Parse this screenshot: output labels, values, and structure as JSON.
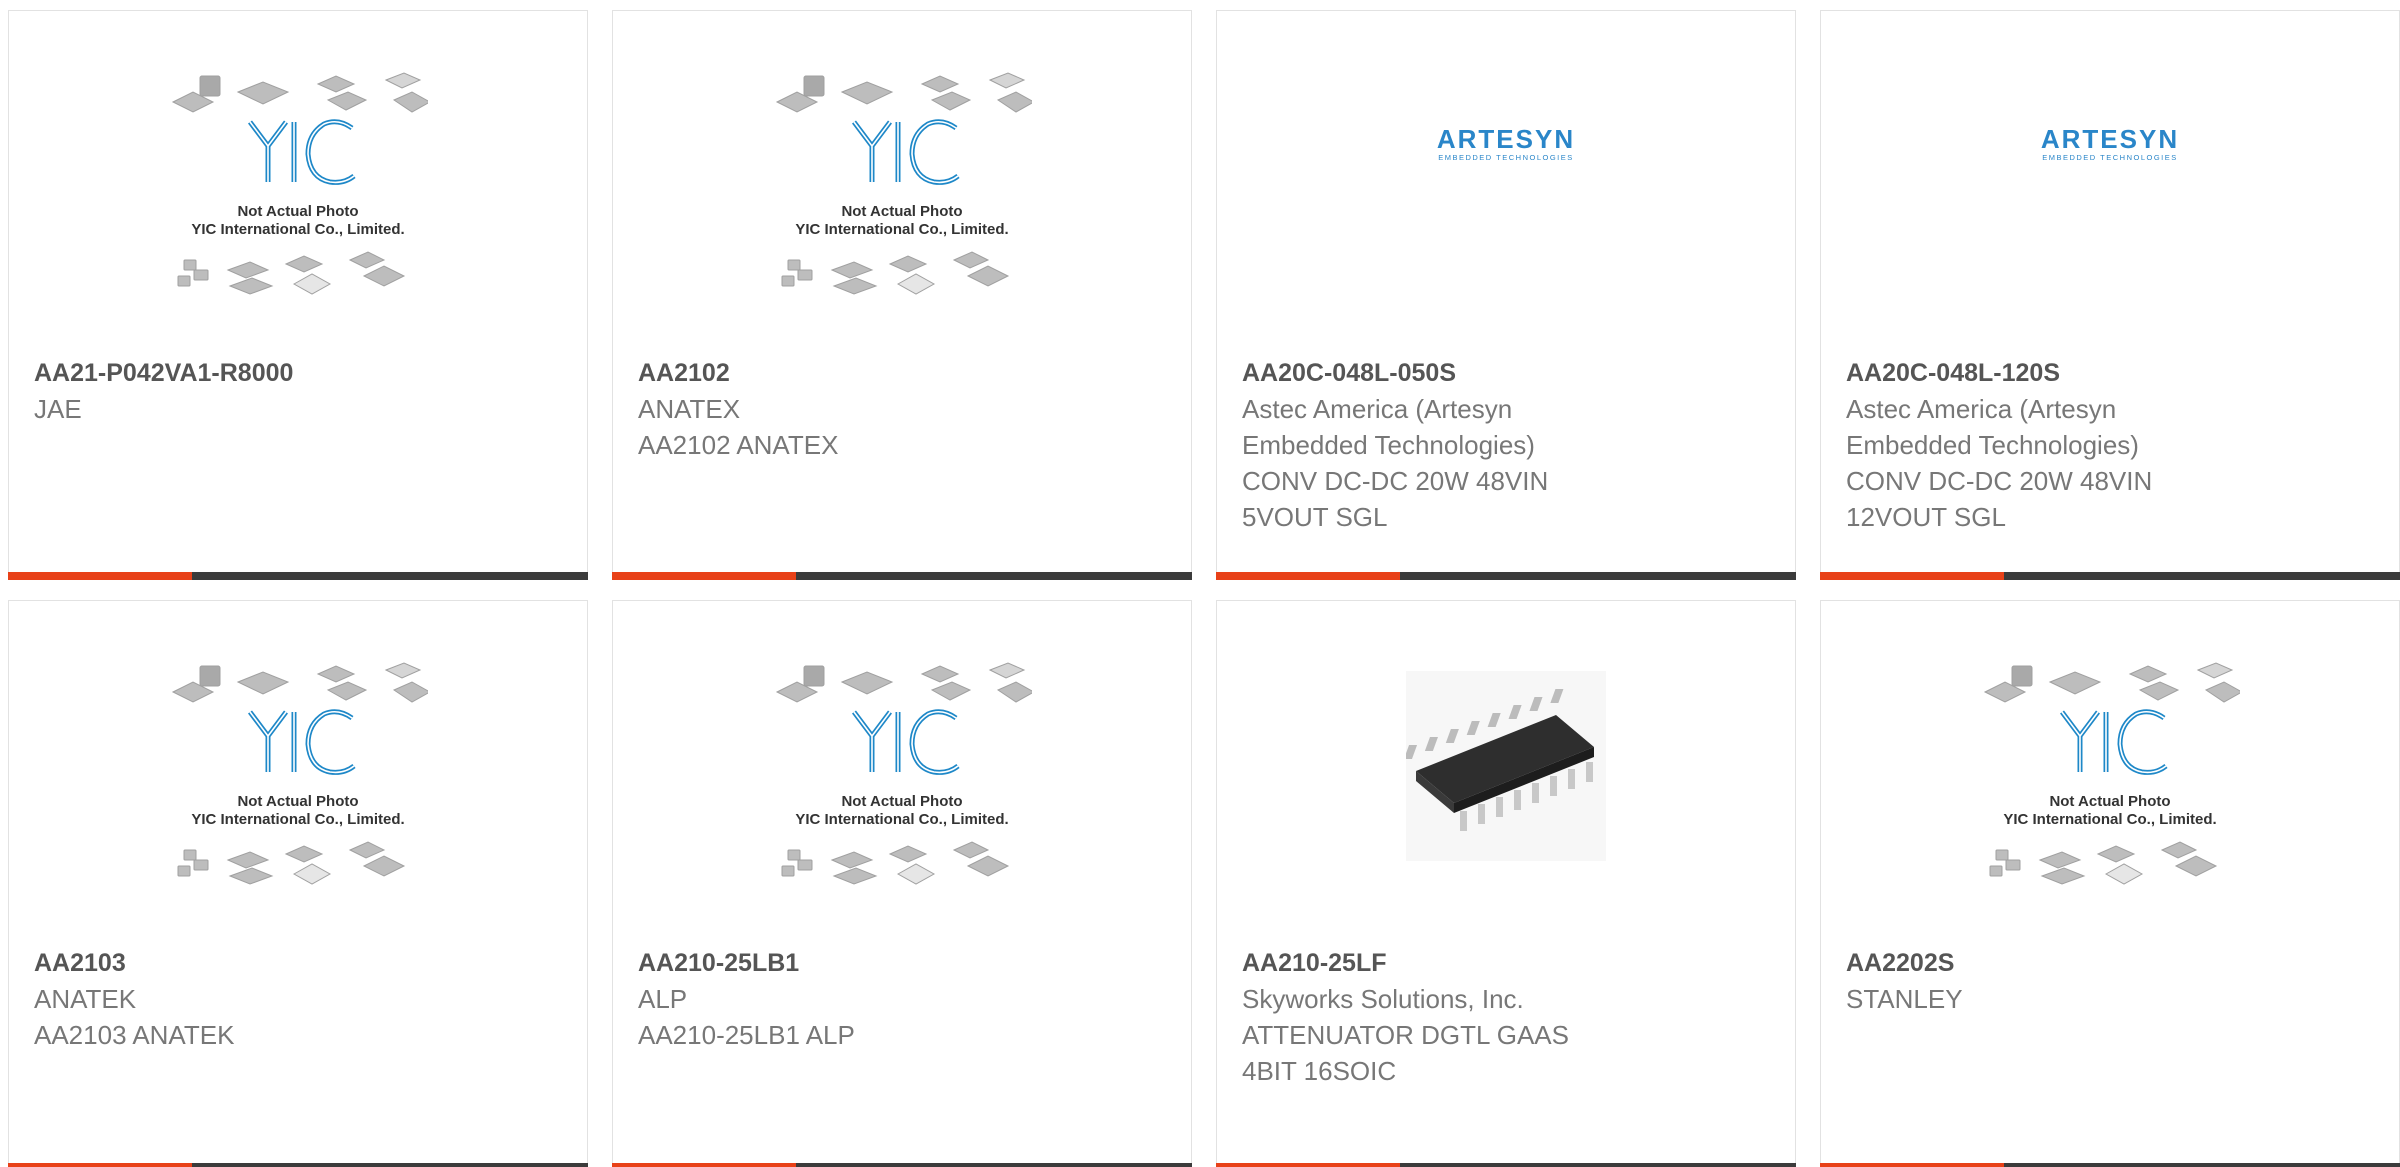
{
  "colors": {
    "accent": "#e84118",
    "bar": "#3b3b3b",
    "yic_blue": "#1e88c8",
    "artesyn_blue": "#2a86c9"
  },
  "placeholder": {
    "line1": "Not Actual Photo",
    "line2": "YIC International Co., Limited.",
    "logo": "YIC"
  },
  "artesyn": {
    "logo": "ARTESYN",
    "sub": "EMBEDDED TECHNOLOGIES"
  },
  "products": [
    {
      "part": "AA21-P042VA1-R8000",
      "manufacturer": "JAE",
      "description": "",
      "image": "yic-placeholder"
    },
    {
      "part": "AA2102",
      "manufacturer": "ANATEX",
      "description": "AA2102 ANATEX",
      "image": "yic-placeholder"
    },
    {
      "part": "AA20C-048L-050S",
      "manufacturer": "Astec America (Artesyn Embedded Technologies)",
      "description": "CONV DC-DC 20W 48VIN 5VOUT SGL",
      "image": "artesyn-logo"
    },
    {
      "part": "AA20C-048L-120S",
      "manufacturer": "Astec America (Artesyn Embedded Technologies)",
      "description": "CONV DC-DC 20W 48VIN 12VOUT SGL",
      "image": "artesyn-logo"
    },
    {
      "part": "AA2103",
      "manufacturer": "ANATEK",
      "description": "AA2103 ANATEK",
      "image": "yic-placeholder"
    },
    {
      "part": "AA210-25LB1",
      "manufacturer": "ALP",
      "description": "AA210-25LB1 ALP",
      "image": "yic-placeholder"
    },
    {
      "part": "AA210-25LF",
      "manufacturer": "Skyworks Solutions, Inc.",
      "description": "ATTENUATOR DGTL GAAS 4BIT 16SOIC",
      "image": "soic-16-chip"
    },
    {
      "part": "AA2202S",
      "manufacturer": "STANLEY",
      "description": "",
      "image": "yic-placeholder"
    }
  ]
}
